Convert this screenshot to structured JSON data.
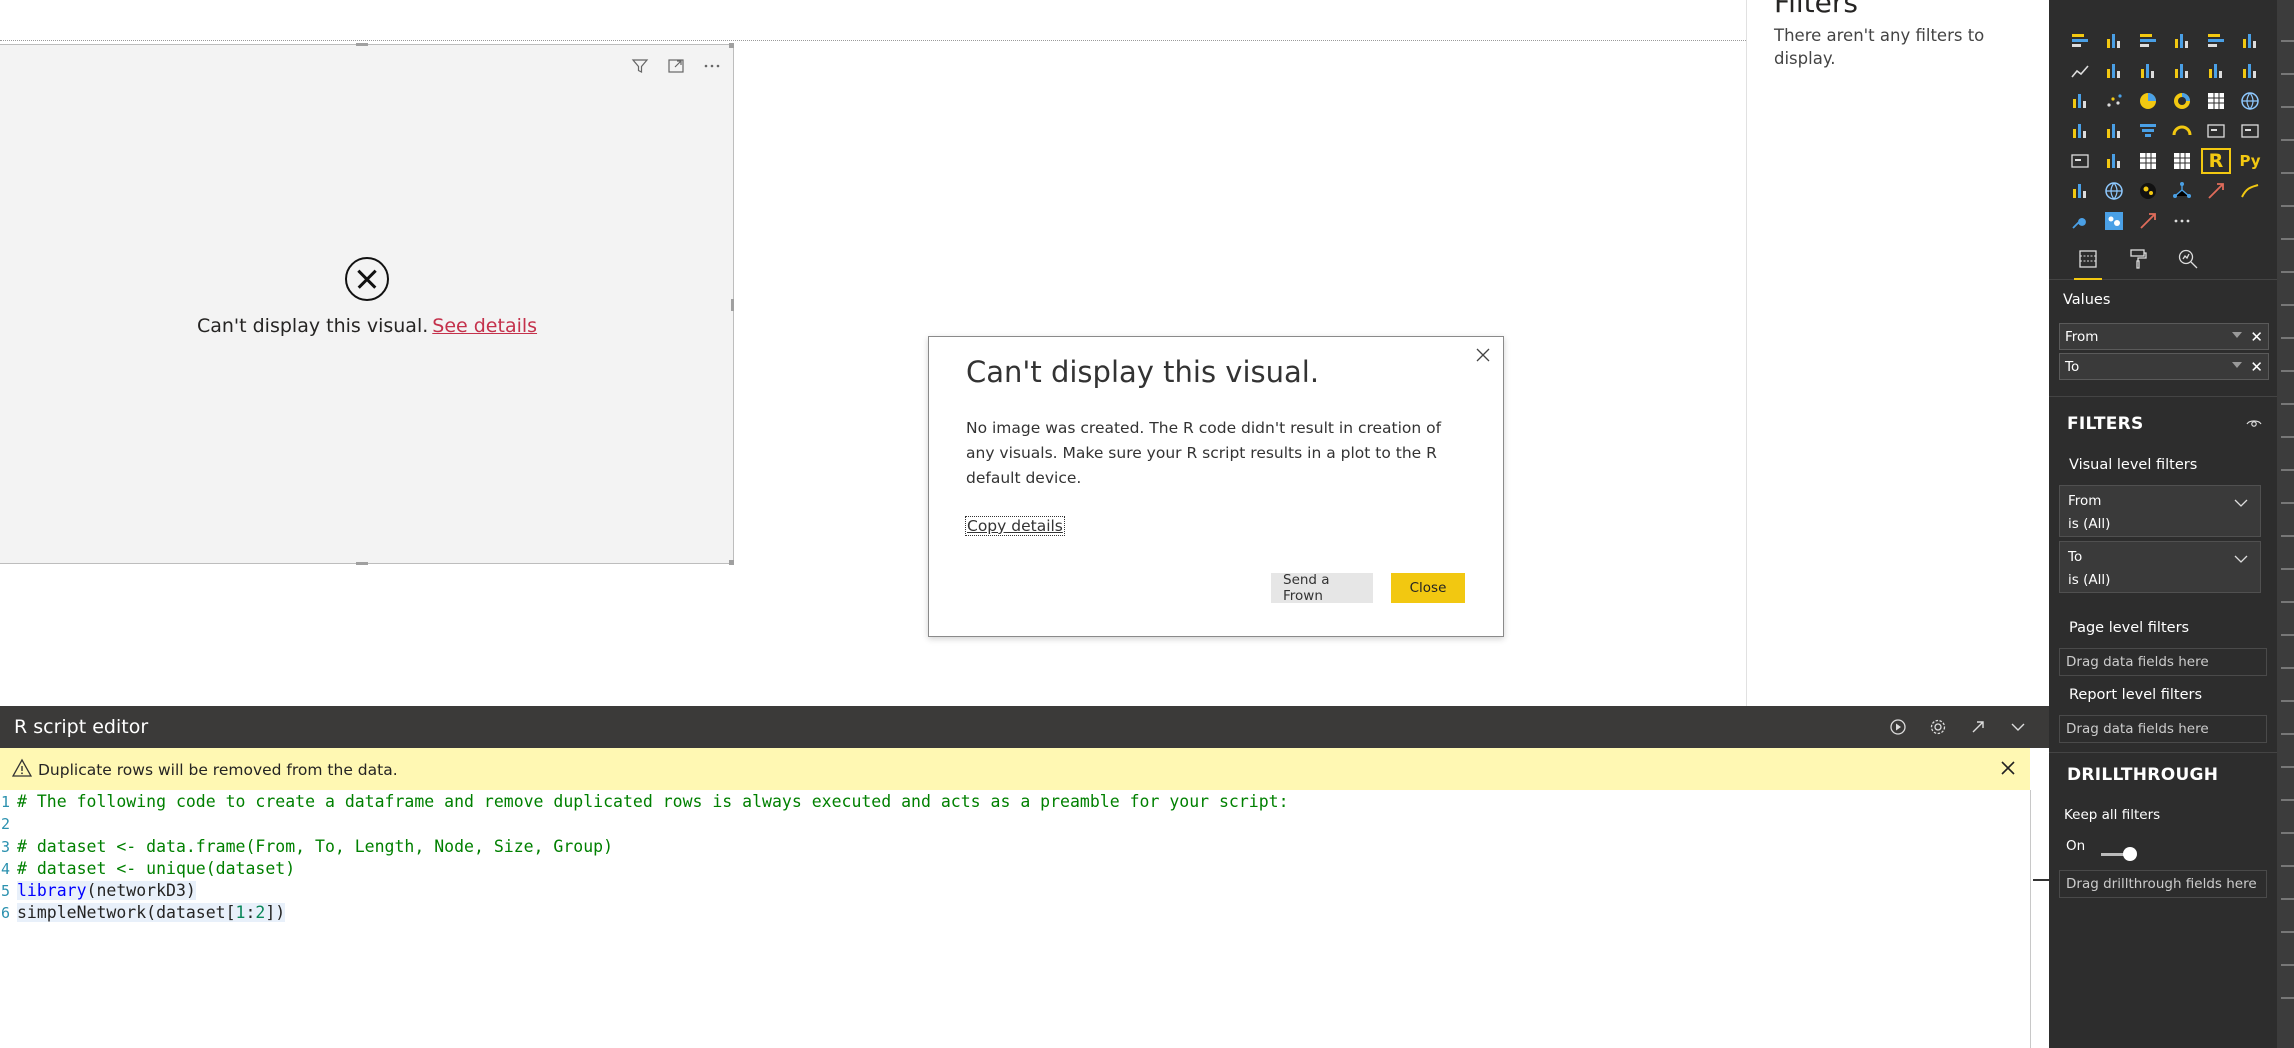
{
  "canvas": {
    "visual": {
      "error_message": "Can't display this visual.",
      "see_details_link": "See details"
    },
    "dialog": {
      "title": "Can't display this visual.",
      "body": "No image was created. The R code didn't result in creation of any visuals. Make sure your R script results in a plot to the R default device.",
      "copy_details": "Copy details",
      "send_frown": "Send a Frown",
      "close": "Close"
    }
  },
  "filters_pane": {
    "header": "Filters",
    "empty_message": "There aren't any filters to display."
  },
  "r_editor": {
    "title": "R script editor",
    "warning": "Duplicate rows will be removed from the data.",
    "lines": [
      {
        "num": "1",
        "text": "# The following code to create a dataframe and remove duplicated rows is always executed and acts as a preamble for your script:"
      },
      {
        "num": "2",
        "text": ""
      },
      {
        "num": "3",
        "text": "# dataset <- data.frame(From, To, Length, Node, Size, Group)"
      },
      {
        "num": "4",
        "text": "# dataset <- unique(dataset)"
      },
      {
        "num": "5",
        "kw": "library",
        "rest": "(networkD3)"
      },
      {
        "num": "6",
        "pre": "simpleNetwork(dataset[",
        "n1": "1",
        "mid": ":",
        "n2": "2",
        "post": "])"
      }
    ]
  },
  "viz_pane": {
    "icons": [
      "stacked-bar-icon",
      "stacked-column-icon",
      "clustered-bar-icon",
      "clustered-column-icon",
      "100-bar-icon",
      "100-column-icon",
      "line-chart-icon",
      "area-chart-icon",
      "stacked-area-icon",
      "line-column-icon",
      "line-clustered-column-icon",
      "ribbon-chart-icon",
      "waterfall-icon",
      "scatter-icon",
      "pie-icon",
      "donut-icon",
      "treemap-icon",
      "map-icon",
      "filled-map-icon",
      "shape-map-icon",
      "funnel-icon",
      "gauge-icon",
      "card-icon",
      "multirow-card-icon",
      "kpi-icon",
      "slicer-icon",
      "table-icon",
      "matrix-icon",
      "r-visual-icon",
      "python-visual-icon",
      "key-influencers-icon",
      "globe-icon",
      "bubble-icon",
      "network-icon",
      "arrow-icon",
      "arcgis-icon",
      "custom-visual-1-icon",
      "custom-visual-2-icon",
      "custom-visual-3-icon",
      "more-icon"
    ],
    "values_label": "Values",
    "wells": [
      "From",
      "To"
    ],
    "filters_header": "FILTERS",
    "visual_level_filters": "Visual level filters",
    "filter_cards": [
      {
        "field": "From",
        "state": "is (All)"
      },
      {
        "field": "To",
        "state": "is (All)"
      }
    ],
    "page_level_filters": "Page level filters",
    "report_level_filters": "Report level filters",
    "drag_fields": "Drag data fields here",
    "drillthrough_header": "DRILLTHROUGH",
    "keep_all_filters": "Keep all filters",
    "toggle_state": "On",
    "drag_drillthrough": "Drag drillthrough fields here"
  },
  "colors": {
    "accent": "#f2c811",
    "editor_bar": "#3b3a39",
    "warning_bg": "#fff8b3",
    "pane_bg": "#2d2d2d",
    "link_red": "#c4314b"
  }
}
